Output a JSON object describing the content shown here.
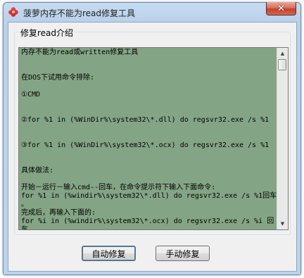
{
  "window": {
    "title": "菠萝内存不能为read修复工具",
    "close_label": "✕"
  },
  "group": {
    "label": "修复read介绍"
  },
  "content": {
    "lines": [
      "内存不能为read或written修复工具",
      "",
      "",
      "在DOS下试用命令排除:",
      "",
      "①CMD",
      "",
      "",
      "②for %1 in (%WinDir%\\system32\\*.dll) do regsvr32.exe /s %1",
      "",
      "",
      "③for %1 in (%WinDir%\\system32\\*.ocx) do regsvr32.exe /s %1",
      "",
      "",
      "具体做法:",
      "",
      "开始－运行－输入cmd--回车，在命令提示符下输入下面命令:",
      "for %1 in (%windir%\\system32\\*.dll) do regsvr32.exe /s %1回车",
      "。",
      "完成后，再输入下面的:",
      "for %i in (%windir%\\system32\\*.ocx) do regsvr32.exe /s %i 回",
      "车。"
    ]
  },
  "buttons": {
    "auto_repair": "自动修复",
    "manual_repair": "手动修复"
  },
  "colors": {
    "text_background": "#84a585",
    "close_button": "#c5412b"
  },
  "icons": {
    "app": "flower-icon",
    "scroll_up": "triangle-up-icon",
    "scroll_down": "triangle-down-icon"
  }
}
